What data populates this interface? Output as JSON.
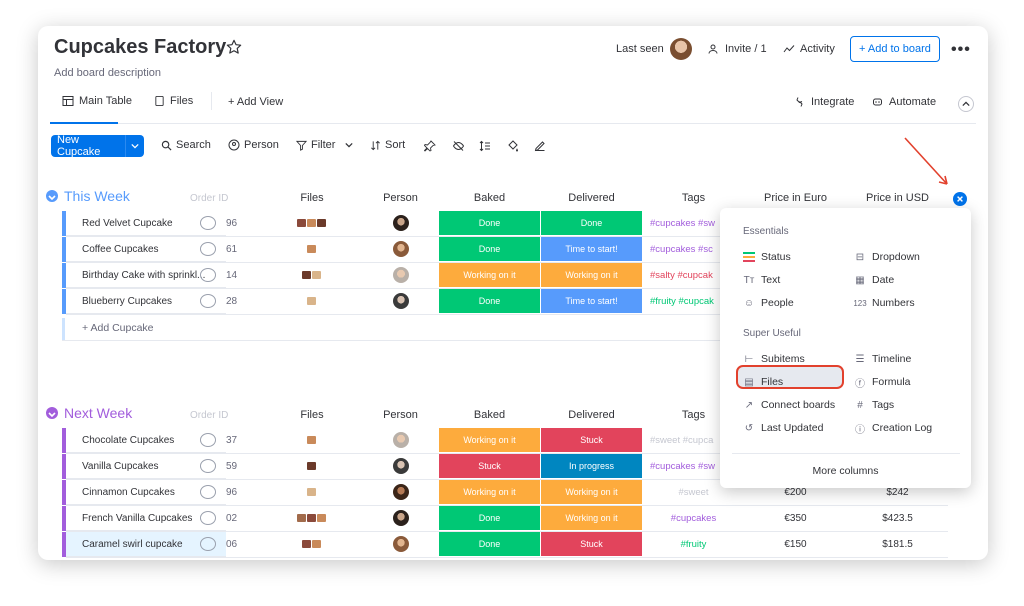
{
  "board": {
    "title": "Cupcakes Factory",
    "description": "Add board description",
    "last_seen": "Last seen",
    "invite": "Invite / 1",
    "activity": "Activity",
    "add_to_board": "+ Add to board"
  },
  "tabs": {
    "main_table": "Main Table",
    "files": "Files",
    "add_view": "+ Add View",
    "integrate": "Integrate",
    "automate": "Automate"
  },
  "toolbar": {
    "new_item": "New Cupcake",
    "search": "Search",
    "person": "Person",
    "filter": "Filter",
    "sort": "Sort"
  },
  "columns": {
    "order_id": "Order ID",
    "files": "Files",
    "person": "Person",
    "baked": "Baked",
    "delivered": "Delivered",
    "tags": "Tags",
    "price_euro": "Price in Euro",
    "price_usd": "Price in USD"
  },
  "groups": [
    {
      "title": "This Week",
      "color": "#579bfc",
      "add_item": "+ Add Cupcake",
      "rows": [
        {
          "name": "Red Velvet Cupcake",
          "order": "96",
          "baked": "Done",
          "baked_color": "#00c875",
          "delivered": "Done",
          "delivered_color": "#00c875",
          "tags": "#cupcakes #sw"
        },
        {
          "name": "Coffee Cupcakes",
          "order": "61",
          "baked": "Done",
          "baked_color": "#00c875",
          "delivered": "Time to start!",
          "delivered_color": "#579bfc",
          "tags": "#cupcakes #sc"
        },
        {
          "name": "Birthday Cake with sprinkl...",
          "order": "14",
          "baked": "Working on it",
          "baked_color": "#fdab3d",
          "delivered": "Working on it",
          "delivered_color": "#fdab3d",
          "tags": "#salty #cupcak"
        },
        {
          "name": "Blueberry Cupcakes",
          "order": "28",
          "baked": "Done",
          "baked_color": "#00c875",
          "delivered": "Time to start!",
          "delivered_color": "#579bfc",
          "tags": "#fruity #cupcak"
        }
      ]
    },
    {
      "title": "Next Week",
      "color": "#a25ddc",
      "rows": [
        {
          "name": "Chocolate Cupcakes",
          "order": "37",
          "baked": "Working on it",
          "baked_color": "#fdab3d",
          "delivered": "Stuck",
          "delivered_color": "#e2445c",
          "tags": "#sweet #cupca",
          "euro": "",
          "usd": ""
        },
        {
          "name": "Vanilla Cupcakes",
          "order": "59",
          "baked": "Stuck",
          "baked_color": "#e2445c",
          "delivered": "In progress",
          "delivered_color": "#0086c0",
          "tags": "#cupcakes #sw",
          "euro": "",
          "usd": ""
        },
        {
          "name": "Cinnamon Cupcakes",
          "order": "96",
          "baked": "Working on it",
          "baked_color": "#fdab3d",
          "delivered": "Working on it",
          "delivered_color": "#fdab3d",
          "tags": "#sweet",
          "euro": "€200",
          "usd": "$242"
        },
        {
          "name": "French Vanilla Cupcakes",
          "order": "02",
          "baked": "Done",
          "baked_color": "#00c875",
          "delivered": "Working on it",
          "delivered_color": "#fdab3d",
          "tags": "#cupcakes",
          "euro": "€350",
          "usd": "$423.5"
        },
        {
          "name": "Caramel swirl cupcake",
          "order": "06",
          "baked": "Done",
          "baked_color": "#00c875",
          "delivered": "Stuck",
          "delivered_color": "#e2445c",
          "tags": "#fruity",
          "euro": "€150",
          "usd": "$181.5"
        }
      ]
    }
  ],
  "column_picker": {
    "essentials_heading": "Essentials",
    "super_useful_heading": "Super Useful",
    "essentials": [
      "Status",
      "Dropdown",
      "Text",
      "Date",
      "People",
      "Numbers"
    ],
    "super_useful": [
      "Subitems",
      "Timeline",
      "Files",
      "Formula",
      "Connect boards",
      "Tags",
      "Last Updated",
      "Creation Log"
    ],
    "more_columns": "More columns"
  },
  "colors": {
    "accent": "#0073ea",
    "done": "#00c875",
    "working": "#fdab3d",
    "stuck": "#e2445c",
    "time_to_start": "#579bfc",
    "in_progress": "#0086c0",
    "annotation_red": "#e2412d"
  }
}
